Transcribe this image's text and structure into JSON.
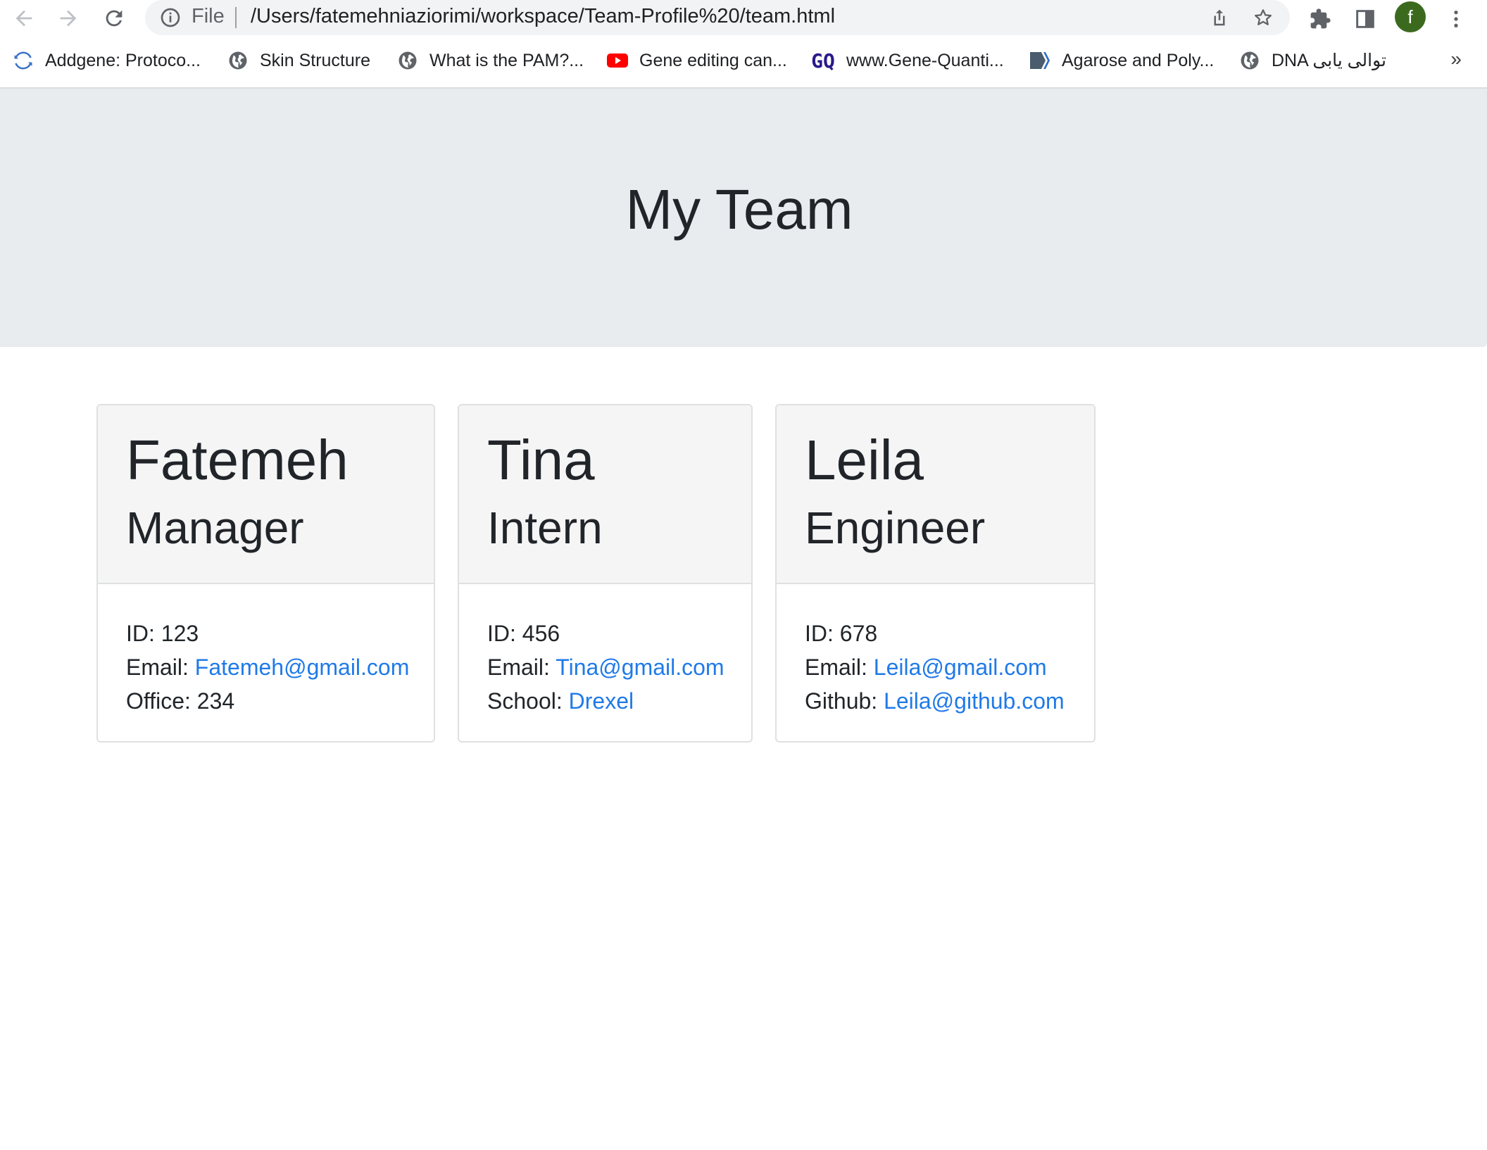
{
  "browser": {
    "scheme_label": "File",
    "url": "/Users/fatemehniaziorimi/workspace/Team-Profile%20/team.html",
    "profile_initial": "f",
    "bookmarks": [
      {
        "label": "Addgene: Protoco...",
        "icon": "sync-icon"
      },
      {
        "label": "Skin Structure",
        "icon": "globe-icon"
      },
      {
        "label": "What is the PAM?...",
        "icon": "globe-icon"
      },
      {
        "label": "Gene editing can...",
        "icon": "youtube-icon"
      },
      {
        "label": "www.Gene-Quanti...",
        "icon": "gq-icon"
      },
      {
        "label": "Agarose and Poly...",
        "icon": "slides-icon"
      },
      {
        "label": "DNA توالی یابی",
        "icon": "globe-icon"
      }
    ],
    "more_label": "»",
    "gq_text": "GQ"
  },
  "page": {
    "title": "My Team",
    "accent_color": "#1f7ae8"
  },
  "team": [
    {
      "name": "Fatemeh",
      "role": "Manager",
      "id_label": "ID: ",
      "id": "123",
      "email_label": "Email: ",
      "email": "Fatemeh@gmail.com",
      "extra_label": "Office: ",
      "extra_value": "234"
    },
    {
      "name": "Tina",
      "role": "Intern",
      "id_label": "ID: ",
      "id": "456",
      "email_label": "Email: ",
      "email": "Tina@gmail.com",
      "extra_label": "School: ",
      "extra_value": "Drexel"
    },
    {
      "name": "Leila",
      "role": "Engineer",
      "id_label": "ID: ",
      "id": "678",
      "email_label": "Email: ",
      "email": "Leila@gmail.com",
      "extra_label": "Github: ",
      "extra_value": "Leila@github.com"
    }
  ]
}
